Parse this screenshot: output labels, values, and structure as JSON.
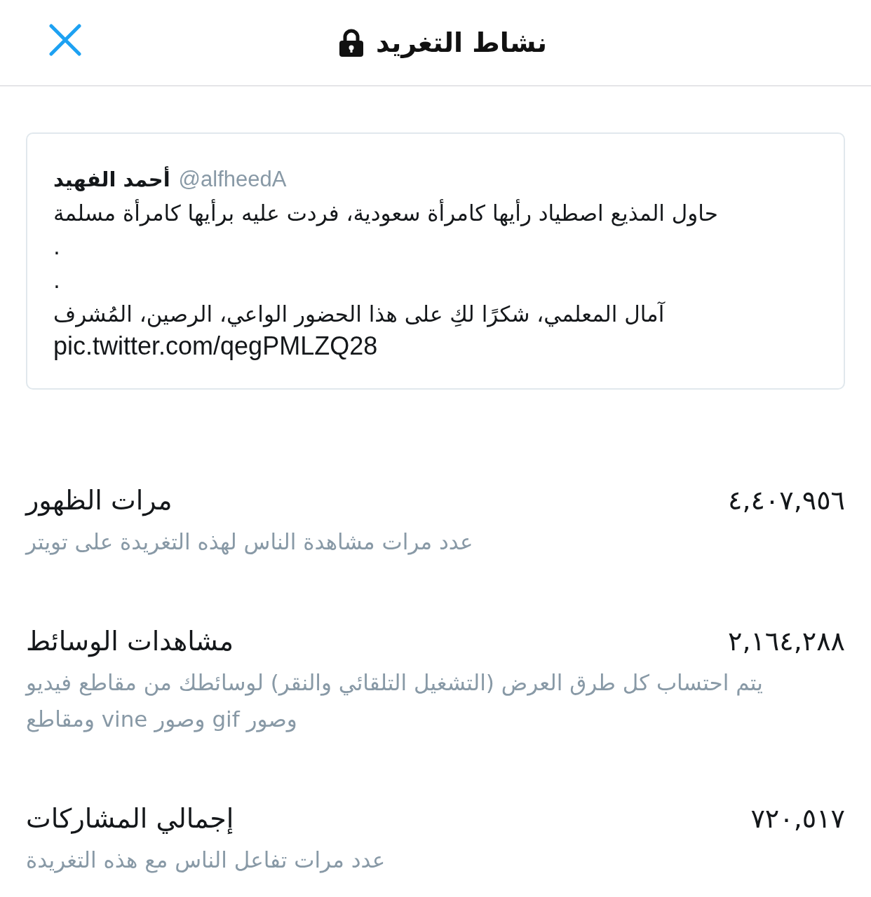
{
  "header": {
    "title": "نشاط التغريد"
  },
  "tweet": {
    "author": "أحمد الفهيد",
    "handle": "@alfheedA",
    "lines": [
      "حاول المذيع اصطياد رأيها كامرأة سعودية، فردت عليه برأيها كامرأة مسلمة",
      ".",
      ".",
      "آمال المعلمي، شكرًا لكِ على هذا الحضور الواعي، الرصين، المُشرف"
    ],
    "link": "pic.twitter.com/qegPMLZQ28"
  },
  "stats": [
    {
      "label": "مرات الظهور",
      "value": "٤,٤٠٧,٩٥٦",
      "description": "عدد مرات مشاهدة الناس لهذه التغريدة على تويتر"
    },
    {
      "label": "مشاهدات الوسائط",
      "value": "٢,١٦٤,٢٨٨",
      "description": "يتم احتساب كل طرق العرض (التشغيل التلقائي والنقر) لوسائطك من مقاطع فيديو وصور gif وصور vine ومقاطع"
    },
    {
      "label": "إجمالي المشاركات",
      "value": "٧٢٠,٥١٧",
      "description": "عدد مرات تفاعل الناس مع هذه التغريدة"
    }
  ]
}
